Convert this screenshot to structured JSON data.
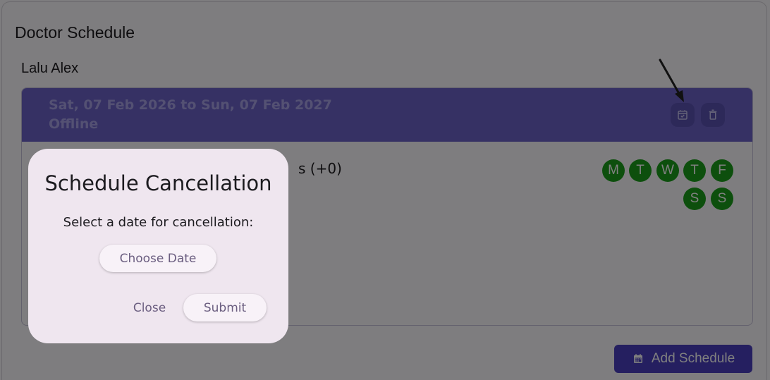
{
  "page": {
    "title": "Doctor Schedule",
    "doctor_name": "Lalu Alex"
  },
  "schedule": {
    "date_range": "Sat, 07 Feb 2026 to Sun, 07 Feb 2027",
    "mode": "Offline",
    "slot_text_visible": "s (+0)",
    "days": [
      {
        "label": "M"
      },
      {
        "label": "T"
      },
      {
        "label": "W"
      },
      {
        "label": "T"
      },
      {
        "label": "F"
      },
      {
        "label": "S"
      },
      {
        "label": "S"
      }
    ],
    "icons": {
      "calendar": "calendar-check-icon",
      "delete": "trash-icon"
    }
  },
  "actions": {
    "add_schedule_label": "Add Schedule",
    "add_schedule_icon": "calendar-icon"
  },
  "dialog": {
    "title": "Schedule Cancellation",
    "message": "Select a date for cancellation:",
    "choose_date_label": "Choose Date",
    "close_label": "Close",
    "submit_label": "Submit"
  },
  "colors": {
    "header": "#6c63c8",
    "day_green": "#1b9e1b",
    "primary": "#4a3fc0",
    "dialog_bg": "#efe6ef"
  }
}
